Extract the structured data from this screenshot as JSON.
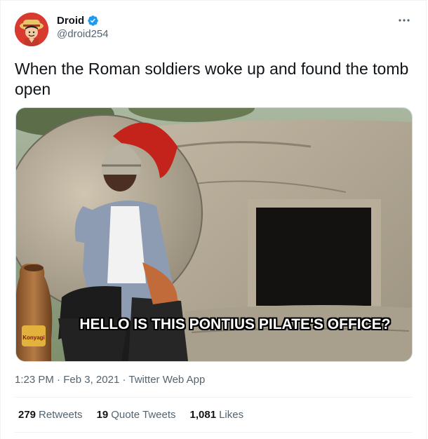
{
  "tweet": {
    "display_name": "Droid",
    "handle": "@droid254",
    "verified": true,
    "more_icon": "more-horizontal-icon",
    "text": "When the Roman soldiers woke up and found the tomb open",
    "media": {
      "caption": "HELLO IS THIS PONTIUS PILATE'S OFFICE?",
      "jar_label": "Konyagi"
    },
    "time": "1:23 PM",
    "date": "Feb 3, 2021",
    "source": "Twitter Web App",
    "separator": "·",
    "stats": {
      "retweets_count": "279",
      "retweets_label": "Retweets",
      "quote_count": "19",
      "quote_label": "Quote Tweets",
      "likes_count": "1,081",
      "likes_label": "Likes"
    },
    "colors": {
      "text": "#0f1419",
      "secondary": "#536471",
      "verified": "#1d9bf0",
      "border": "#eff3f4"
    }
  }
}
